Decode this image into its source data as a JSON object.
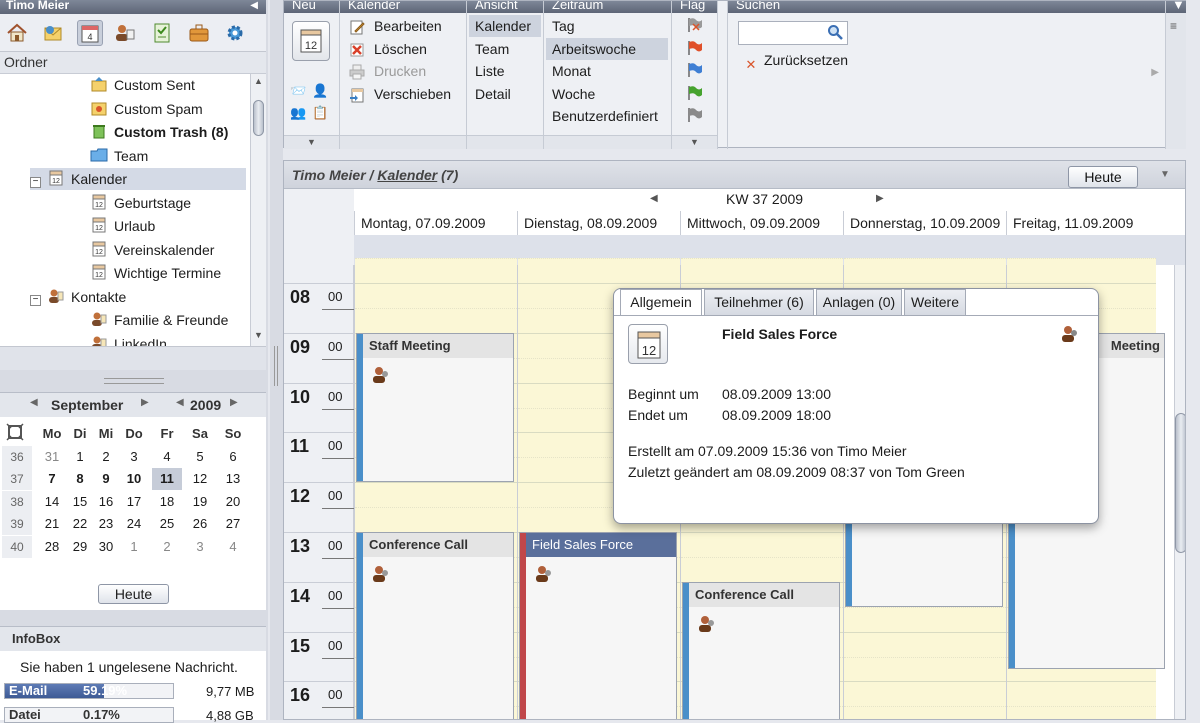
{
  "nav": {
    "user_title": "Timo Meier",
    "ordner_label": "Ordner",
    "tree": [
      {
        "label": "Custom Sent",
        "icon": "sent-folder-icon",
        "indent": 2,
        "bold": false
      },
      {
        "label": "Custom Spam",
        "icon": "spam-folder-icon",
        "indent": 2,
        "bold": false
      },
      {
        "label": "Custom Trash (8)",
        "icon": "trash-folder-icon",
        "indent": 2,
        "bold": true
      },
      {
        "label": "Team",
        "icon": "folder-icon",
        "indent": 2,
        "bold": false
      },
      {
        "label": "Kalender",
        "icon": "calendar-icon",
        "indent": 1,
        "bold": false,
        "selected": true,
        "expander": "−"
      },
      {
        "label": "Geburtstage",
        "icon": "calendar-icon",
        "indent": 2,
        "bold": false
      },
      {
        "label": "Urlaub",
        "icon": "calendar-icon",
        "indent": 2,
        "bold": false
      },
      {
        "label": "Vereinskalender",
        "icon": "calendar-icon",
        "indent": 2,
        "bold": false
      },
      {
        "label": "Wichtige Termine",
        "icon": "calendar-icon",
        "indent": 2,
        "bold": false
      },
      {
        "label": "Kontakte",
        "icon": "contacts-icon",
        "indent": 1,
        "bold": false,
        "expander": "−"
      },
      {
        "label": "Familie & Freunde",
        "icon": "contacts-icon",
        "indent": 2,
        "bold": false
      },
      {
        "label": "LinkedIn",
        "icon": "contacts-icon",
        "indent": 2,
        "bold": false
      }
    ]
  },
  "minical": {
    "month": "September",
    "year": "2009",
    "weekdays": [
      "Mo",
      "Di",
      "Mi",
      "Do",
      "Fr",
      "Sa",
      "So"
    ],
    "weeks": [
      {
        "wk": "36",
        "days": [
          "31",
          "1",
          "2",
          "3",
          "4",
          "5",
          "6"
        ]
      },
      {
        "wk": "37",
        "days": [
          "7",
          "8",
          "9",
          "10",
          "11",
          "12",
          "13"
        ]
      },
      {
        "wk": "38",
        "days": [
          "14",
          "15",
          "16",
          "17",
          "18",
          "19",
          "20"
        ]
      },
      {
        "wk": "39",
        "days": [
          "21",
          "22",
          "23",
          "24",
          "25",
          "26",
          "27"
        ]
      },
      {
        "wk": "40",
        "days": [
          "28",
          "29",
          "30",
          "1",
          "2",
          "3",
          "4"
        ]
      }
    ],
    "heute_label": "Heute"
  },
  "infobox": {
    "title": "InfoBox",
    "message": "Sie haben 1 ungelesene Nachricht.",
    "quotas": [
      {
        "label": "E-Mail",
        "percent_text": "59.19%",
        "percent": 59.19,
        "size": "9,77 MB"
      },
      {
        "label": "Datei",
        "percent_text": "0.17%",
        "percent": 0.17,
        "size": "4,88 GB"
      }
    ]
  },
  "ribbon": {
    "neu": {
      "title": "Neu"
    },
    "kalender": {
      "title": "Kalender",
      "items": [
        {
          "label": "Bearbeiten",
          "icon": "edit-icon",
          "disabled": false
        },
        {
          "label": "Löschen",
          "icon": "delete-icon",
          "disabled": false
        },
        {
          "label": "Drucken",
          "icon": "print-icon",
          "disabled": true
        },
        {
          "label": "Verschieben",
          "icon": "move-icon",
          "disabled": false
        }
      ]
    },
    "ansicht": {
      "title": "Ansicht",
      "items": [
        {
          "label": "Kalender",
          "active": true
        },
        {
          "label": "Team",
          "active": false
        },
        {
          "label": "Liste",
          "active": false
        },
        {
          "label": "Detail",
          "active": false
        }
      ]
    },
    "zeitraum": {
      "title": "Zeitraum",
      "items": [
        {
          "label": "Tag",
          "active": false
        },
        {
          "label": "Arbeitswoche",
          "active": true
        },
        {
          "label": "Monat",
          "active": false
        },
        {
          "label": "Woche",
          "active": false
        },
        {
          "label": "Benutzerdefiniert",
          "active": false
        }
      ]
    },
    "flag": {
      "title": "Flag",
      "flags": [
        {
          "icon": "flag-clear-icon",
          "color": "#9a9a9a"
        },
        {
          "icon": "flag-red-icon",
          "color": "#e0502a"
        },
        {
          "icon": "flag-blue-icon",
          "color": "#3f7fd4"
        },
        {
          "icon": "flag-green-icon",
          "color": "#46a32e"
        },
        {
          "icon": "flag-grey-icon",
          "color": "#8a8a8a"
        }
      ]
    },
    "suchen": {
      "title": "Suchen",
      "search_placeholder": "",
      "reset_label": "Zurücksetzen"
    }
  },
  "calendar": {
    "breadcrumb_user": "Timo Meier",
    "breadcrumb_sep": "/",
    "breadcrumb_cal": "Kalender",
    "breadcrumb_count": "(7)",
    "heute_label": "Heute",
    "week_label": "KW 37 2009",
    "days": [
      "Montag, 07.09.2009",
      "Dienstag, 08.09.2009",
      "Mittwoch, 09.09.2009",
      "Donnerstag, 10.09.2009",
      "Freitag, 11.09.2009"
    ],
    "hours": [
      {
        "h": "08",
        "m": "00"
      },
      {
        "h": "09",
        "m": "00"
      },
      {
        "h": "10",
        "m": "00"
      },
      {
        "h": "11",
        "m": "00"
      },
      {
        "h": "12",
        "m": "00"
      },
      {
        "h": "13",
        "m": "00"
      },
      {
        "h": "14",
        "m": "00"
      },
      {
        "h": "15",
        "m": "00"
      },
      {
        "h": "16",
        "m": "00"
      }
    ],
    "events": [
      {
        "title": "Staff Meeting",
        "day": 0,
        "start": "09:00",
        "end": "12:00",
        "bar_color": "#4a8fc9"
      },
      {
        "title": "Conference Call",
        "day": 0,
        "start": "13:00",
        "end": "17:00",
        "bar_color": "#4a8fc9"
      },
      {
        "title": "Field Sales Force",
        "day": 1,
        "start": "13:00",
        "end": "18:00",
        "bar_color": "#c0474a",
        "selected": true
      },
      {
        "title": "Conference Call",
        "day": 2,
        "start": "14:00",
        "end": "17:00",
        "bar_color": "#4a8fc9"
      },
      {
        "title": "",
        "day": 3,
        "start": "09:00",
        "end": "14:30",
        "bar_color": "#4a8fc9"
      },
      {
        "title": "Meeting",
        "day": 4,
        "start": "09:00",
        "end": "15:45",
        "bar_color": "#4a8fc9"
      }
    ]
  },
  "popup": {
    "tabs": [
      "Allgemein",
      "Teilnehmer (6)",
      "Anlagen (0)",
      "Weitere"
    ],
    "title": "Field Sales Force",
    "begin_label": "Beginnt um",
    "begin_value": "08.09.2009 13:00",
    "end_label": "Endet um",
    "end_value": "08.09.2009 18:00",
    "created": "Erstellt am 07.09.2009 15:36 von Timo Meier",
    "modified": "Zuletzt geändert am 08.09.2009 08:37 von Tom Green"
  }
}
